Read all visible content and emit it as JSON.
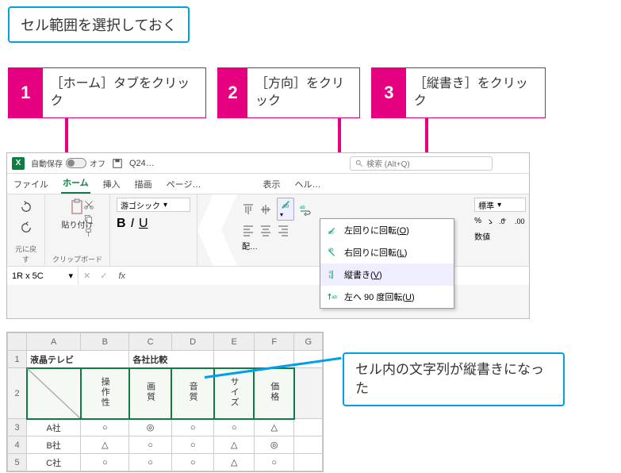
{
  "intro": "セル範囲を選択しておく",
  "steps": {
    "s1": {
      "num": "1",
      "text": "［ホーム］タブをクリック"
    },
    "s2": {
      "num": "2",
      "text": "［方向］をクリック"
    },
    "s3": {
      "num": "3",
      "text": "［縦書き］をクリック"
    }
  },
  "titlebar": {
    "autosave_label": "自動保存",
    "autosave_state": "オフ",
    "doc": "Q24…",
    "search_placeholder": "検索 (Alt+Q)"
  },
  "tabs": {
    "file": "ファイル",
    "home": "ホーム",
    "insert": "挿入",
    "draw": "描画",
    "page": "ページ…",
    "view": "表示",
    "help": "ヘル…"
  },
  "ribbon": {
    "undo_group": "元に戻す",
    "clipboard_group": "クリップボード",
    "paste_label": "貼り付け",
    "font_name": "游ゴシック",
    "bold": "B",
    "italic": "I",
    "underline": "U",
    "number_format": "標準",
    "number_group": "数値",
    "align_group": "配…"
  },
  "orientation_menu": {
    "ccw": "左回りに回転(O)",
    "cw": "右回りに回転(L)",
    "vertical": "縦書き(V)",
    "up90": "左へ 90 度回転(U)"
  },
  "namebox": "1R x 5C",
  "sheet": {
    "title_a": "液晶テレビ",
    "title_b": "各社比較",
    "headers": [
      "操作性",
      "画質",
      "音質",
      "サイズ",
      "価格"
    ],
    "rows": [
      {
        "label": "A社",
        "cells": [
          "○",
          "◎",
          "○",
          "○",
          "△"
        ]
      },
      {
        "label": "B社",
        "cells": [
          "△",
          "○",
          "○",
          "△",
          "◎"
        ]
      },
      {
        "label": "C社",
        "cells": [
          "○",
          "○",
          "○",
          "△",
          "○"
        ]
      }
    ],
    "cols": [
      "A",
      "B",
      "C",
      "D",
      "E",
      "F",
      "G"
    ]
  },
  "result": "セル内の文字列が縦書きになった",
  "chart_data": {
    "type": "table",
    "title": "液晶テレビ 各社比較",
    "columns": [
      "操作性",
      "画質",
      "音質",
      "サイズ",
      "価格"
    ],
    "rows": [
      "A社",
      "B社",
      "C社"
    ],
    "values": [
      [
        "○",
        "◎",
        "○",
        "○",
        "△"
      ],
      [
        "△",
        "○",
        "○",
        "△",
        "◎"
      ],
      [
        "○",
        "○",
        "○",
        "△",
        "○"
      ]
    ]
  }
}
